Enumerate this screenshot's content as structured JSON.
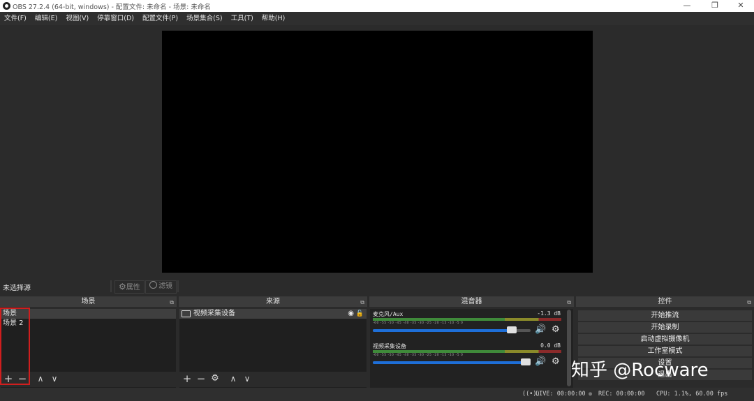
{
  "window": {
    "title": "OBS 27.2.4 (64-bit, windows) - 配置文件: 未命名 - 场景: 未命名",
    "minimize": "—",
    "restore": "❐",
    "close": "✕"
  },
  "menu": [
    "文件(F)",
    "编辑(E)",
    "视图(V)",
    "停靠窗口(D)",
    "配置文件(P)",
    "场景集合(S)",
    "工具(T)",
    "帮助(H)"
  ],
  "context": {
    "no_source": "未选择源",
    "properties": "属性",
    "filters": "滤镜"
  },
  "docks": {
    "scenes": {
      "title": "场景",
      "items": [
        "场景",
        "场景 2"
      ]
    },
    "sources": {
      "title": "来源",
      "items": [
        "视频采集设备"
      ]
    },
    "mixer": {
      "title": "混音器",
      "scale": "-60 -55 -50 -45 -40 -35 -30 -25 -20 -15 -10 -5 0",
      "channels": [
        {
          "name": "麦克风/Aux",
          "db": "-1.3 dB",
          "volume_fraction": 0.91
        },
        {
          "name": "视频采集设备",
          "db": "0.0 dB",
          "volume_fraction": 1.0
        }
      ]
    },
    "controls": {
      "title": "控件",
      "buttons": [
        "开始推流",
        "开始录制",
        "启动虚拟摄像机",
        "工作室模式",
        "设置",
        "退出"
      ]
    }
  },
  "status": {
    "live": "LIVE: 00:00:00",
    "rec": "REC: 00:00:00",
    "cpu": "CPU: 1.1%, 60.00 fps"
  },
  "watermark": "知乎 @Rocware",
  "icons": {
    "add": "+",
    "remove": "−",
    "up": "∧",
    "down": "∨",
    "gear": "⚙",
    "eye": "👁",
    "lock": "🔒",
    "speaker": "🔊",
    "float": "⧉"
  },
  "colors": {
    "highlight_box": "#d01e1e",
    "slider": "#1e6fd8"
  }
}
